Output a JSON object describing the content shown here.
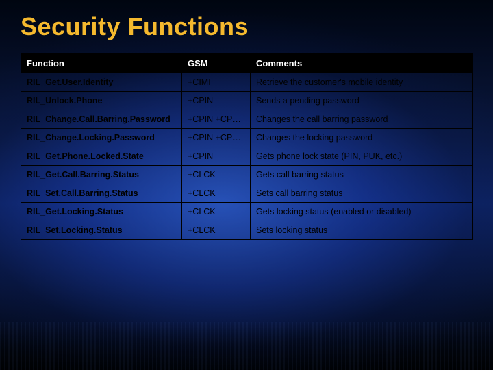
{
  "title": "Security Functions",
  "table": {
    "headers": {
      "c1": "Function",
      "c2": "GSM",
      "c3": "Comments"
    },
    "rows": [
      {
        "fn": "RIL_Get.User.Identity",
        "gsm": "+CIMI",
        "comment": "Retrieve the customer's mobile identity"
      },
      {
        "fn": "RIL_Unlock.Phone",
        "gsm": "+CPIN",
        "comment": "Sends a pending password"
      },
      {
        "fn": "RIL_Change.Call.Barring.Password",
        "gsm": "+CPIN +CPWD",
        "comment": "Changes the call barring password"
      },
      {
        "fn": "RIL_Change.Locking.Password",
        "gsm": "+CPIN +CPWD",
        "comment": "Changes the locking password"
      },
      {
        "fn": "RIL_Get.Phone.Locked.State",
        "gsm": "+CPIN",
        "comment": "Gets phone lock state (PIN, PUK, etc.)"
      },
      {
        "fn": "RIL_Get.Call.Barring.Status",
        "gsm": "+CLCK",
        "comment": "Gets call barring status"
      },
      {
        "fn": "RIL_Set.Call.Barring.Status",
        "gsm": "+CLCK",
        "comment": "Sets call barring status"
      },
      {
        "fn": "RIL_Get.Locking.Status",
        "gsm": "+CLCK",
        "comment": "Gets locking status (enabled or disabled)"
      },
      {
        "fn": "RIL_Set.Locking.Status",
        "gsm": "+CLCK",
        "comment": "Sets locking status"
      }
    ]
  }
}
